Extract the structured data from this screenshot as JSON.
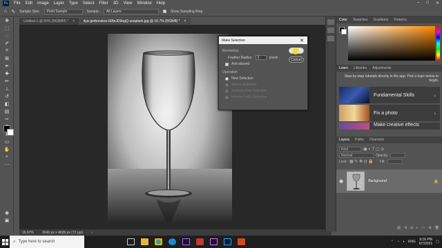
{
  "menubar": {
    "logo": "Ps",
    "items": [
      "File",
      "Edit",
      "Image",
      "Layer",
      "Type",
      "Select",
      "Filter",
      "3D",
      "View",
      "Window",
      "Help"
    ]
  },
  "options": {
    "sample_size_label": "Sample Size:",
    "sample_size_value": "Point Sample",
    "sample_label": "Sample:",
    "sample_value": "All Layers",
    "show_ring_label": "Show Sampling Ring"
  },
  "tabs": [
    {
      "label": "Untitled-1 @ 50% (RGB/8#) *"
    },
    {
      "label": "ilya-gorborukov-iSBoJD9egQ-unsplash.jpg @ 16.7% (RGB/8) *"
    }
  ],
  "status": {
    "zoom": "16.67%",
    "doc": "3042 px x 4636 px (72 ppi)"
  },
  "dialog": {
    "title": "Make Selection",
    "rendering": "Rendering",
    "feather_label": "Feather Radius:",
    "feather_value": "0",
    "feather_unit": "pixels",
    "antialiased": "Anti-aliased",
    "operation": "Operation",
    "ops": [
      "New Selection",
      "Add to Selection",
      "Subtract from Selection",
      "Intersect with Selection"
    ],
    "ok": "OK",
    "cancel": "Cancel"
  },
  "color_panel": {
    "tabs": [
      "Color",
      "Swatches",
      "Gradients",
      "Patterns"
    ]
  },
  "learn_panel": {
    "tabs": [
      "Learn",
      "Libraries",
      "Adjustments"
    ],
    "description": "Step-by-step tutorials directly in the app. Pick a topic below to begin.",
    "cards": [
      "Fundamental Skills",
      "Fix a photo",
      "Make creative effects"
    ]
  },
  "layers_panel": {
    "tabs": [
      "Layers",
      "Paths",
      "Channels"
    ],
    "kind": "Kind",
    "blend": "Normal",
    "opacity_label": "Opacity:",
    "fill_label": "Fill:",
    "lock_label": "Lock:",
    "layer_name": "Background"
  },
  "taskbar": {
    "search_placeholder": "Type here to search",
    "lang": "ENG",
    "time": "9:16 PM",
    "date": "6/7/2021"
  }
}
